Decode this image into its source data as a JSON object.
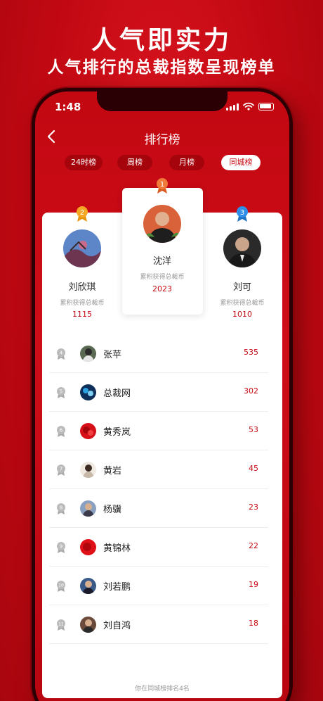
{
  "promo": {
    "headline": "人气即实力",
    "subheadline": "人气排行的总裁指数呈现榜单"
  },
  "status_bar": {
    "time": "1:48"
  },
  "nav": {
    "title": "排行榜"
  },
  "tabs": [
    {
      "label": "24时榜",
      "active": false
    },
    {
      "label": "周榜",
      "active": false
    },
    {
      "label": "月榜",
      "active": false
    },
    {
      "label": "同城榜",
      "active": true
    }
  ],
  "podium": {
    "coin_label": "累积获得总裁币",
    "first": {
      "rank": "1",
      "name": "沈洋",
      "value": "2023"
    },
    "second": {
      "rank": "2",
      "name": "刘欣琪",
      "value": "1115"
    },
    "third": {
      "rank": "3",
      "name": "刘可",
      "value": "1010"
    }
  },
  "list": [
    {
      "rank": "4",
      "name": "张苹",
      "value": "535"
    },
    {
      "rank": "5",
      "name": "总裁网",
      "value": "302"
    },
    {
      "rank": "6",
      "name": "黄秀岚",
      "value": "53"
    },
    {
      "rank": "7",
      "name": "黄岩",
      "value": "45"
    },
    {
      "rank": "8",
      "name": "杨骥",
      "value": "23"
    },
    {
      "rank": "9",
      "name": "黄锦林",
      "value": "22"
    },
    {
      "rank": "10",
      "name": "刘若鹏",
      "value": "19"
    },
    {
      "rank": "11",
      "name": "刘自鸿",
      "value": "18"
    }
  ],
  "footer": {
    "note": "你在同城榜排名4名"
  },
  "colors": {
    "brand_red": "#c70b14",
    "gold": "#f5a623",
    "orange": "#f07a3a",
    "blue": "#2f8fe8",
    "gray": "#bbbbbb"
  }
}
